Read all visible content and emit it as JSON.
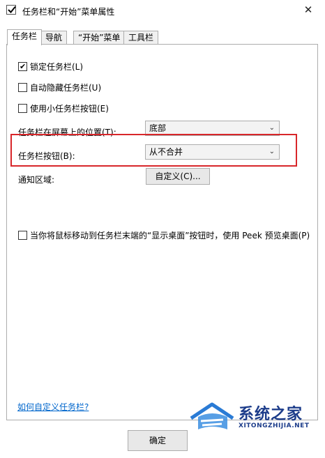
{
  "window": {
    "title": "任务栏和“开始”菜单属性",
    "close_glyph": "✕"
  },
  "tabs": [
    {
      "label": "任务栏",
      "active": true
    },
    {
      "label": "导航",
      "active": false
    },
    {
      "label": "“开始”菜单",
      "active": false
    },
    {
      "label": "工具栏",
      "active": false
    }
  ],
  "taskbar": {
    "lock_taskbar": {
      "label": "锁定任务栏(L)",
      "checked": true
    },
    "auto_hide": {
      "label": "自动隐藏任务栏(U)",
      "checked": false
    },
    "small_buttons": {
      "label": "使用小任务栏按钮(E)",
      "checked": false
    },
    "location": {
      "label": "任务栏在屏幕上的位置(T):",
      "value": "底部"
    },
    "buttons": {
      "label": "任务栏按钮(B):",
      "value": "从不合并"
    },
    "notification_area": {
      "label": "通知区域:",
      "button_label": "自定义(C)..."
    },
    "peek": {
      "label": "当你将鼠标移动到任务栏末端的“显示桌面”按钮时，使用 Peek 预览桌面(P)",
      "checked": false
    },
    "help_link": "如何自定义任务栏?"
  },
  "footer": {
    "ok_label": "确定"
  },
  "watermark": {
    "title": "系统之家",
    "subtitle": "XITONGZHIJIA.NET"
  },
  "colors": {
    "highlight_border": "#d8262a",
    "link": "#0066cc",
    "watermark": "#1c3c8a"
  }
}
